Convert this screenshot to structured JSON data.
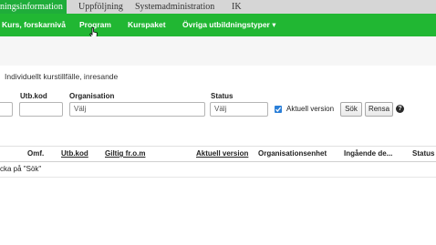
{
  "topnav": {
    "tabs": [
      {
        "label": "ningsinformation",
        "active": true
      },
      {
        "label": "Uppföljning"
      },
      {
        "label": "Systemadministration"
      },
      {
        "label": "IK"
      }
    ]
  },
  "subnav": {
    "items": [
      {
        "label": "Kurs, forskarnivå"
      },
      {
        "label": "Program"
      },
      {
        "label": "Kurspaket"
      },
      {
        "label": "Övriga utbildningstyper ▾"
      }
    ]
  },
  "page": {
    "title": "Individuellt kurstillfälle, inresande"
  },
  "filters": {
    "utbkod_label": "Utb.kod",
    "utbkod_value": "",
    "organisation_label": "Organisation",
    "organisation_value": "Välj",
    "status_label": "Status",
    "status_value": "Välj",
    "aktuell_version_label": "Aktuell version",
    "aktuell_version_checked": true
  },
  "buttons": {
    "search": "Sök",
    "clear": "Rensa",
    "help": "?"
  },
  "table": {
    "columns": [
      "Omf.",
      "Utb.kod",
      "Giltig fr.o.m",
      "Aktuell version",
      "Organisationsenhet",
      "Ingående de...",
      "Status"
    ],
    "empty_message": "cka på \"Sök\""
  },
  "colors": {
    "topbar_bg": "#d6d6d6",
    "active_tab_bg": "#1fad3a",
    "subnav_bg": "#21b733",
    "checkbox": "#2b7fd8"
  }
}
